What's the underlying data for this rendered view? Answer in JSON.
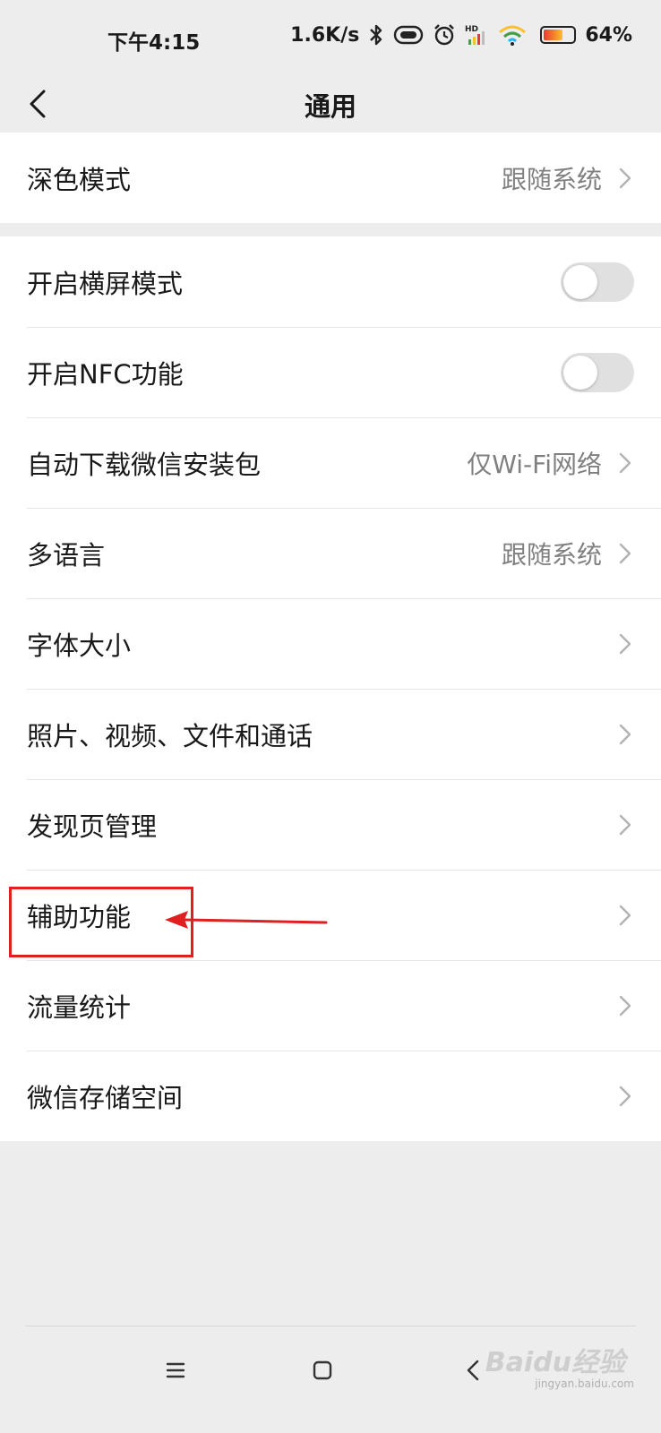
{
  "status_bar": {
    "time": "下午4:15",
    "speed": "1.6K/s",
    "battery_percent": "64%",
    "battery_level": 0.64,
    "icons": [
      "bluetooth-icon",
      "vibrate-icon",
      "alarm-icon",
      "hd-signal-icon",
      "wifi-icon",
      "battery-icon"
    ]
  },
  "nav": {
    "title": "通用",
    "back_icon": "chevron-left-icon"
  },
  "group1": [
    {
      "label": "深色模式",
      "value": "跟随系统",
      "type": "link"
    }
  ],
  "group2": [
    {
      "label": "开启横屏模式",
      "type": "toggle",
      "on": false
    },
    {
      "label": "开启NFC功能",
      "type": "toggle",
      "on": false
    },
    {
      "label": "自动下载微信安装包",
      "value": "仅Wi-Fi网络",
      "type": "link"
    },
    {
      "label": "多语言",
      "value": "跟随系统",
      "type": "link"
    },
    {
      "label": "字体大小",
      "type": "link"
    },
    {
      "label": "照片、视频、文件和通话",
      "type": "link"
    },
    {
      "label": "发现页管理",
      "type": "link"
    },
    {
      "label": "辅助功能",
      "type": "link"
    },
    {
      "label": "流量统计",
      "type": "link"
    },
    {
      "label": "微信存储空间",
      "type": "link"
    }
  ],
  "annotation": {
    "color": "#e02020",
    "target": "辅助功能"
  },
  "system_nav": {
    "icons": [
      "menu-icon",
      "home-icon",
      "back-icon"
    ]
  },
  "watermark": {
    "text": "Baidu经验",
    "sub": "jingyan.baidu.com"
  },
  "colors": {
    "background": "#ededed",
    "surface": "#ffffff",
    "text": "#191919",
    "secondary_text": "#808080",
    "toggle_off": "#e0e0e0"
  }
}
